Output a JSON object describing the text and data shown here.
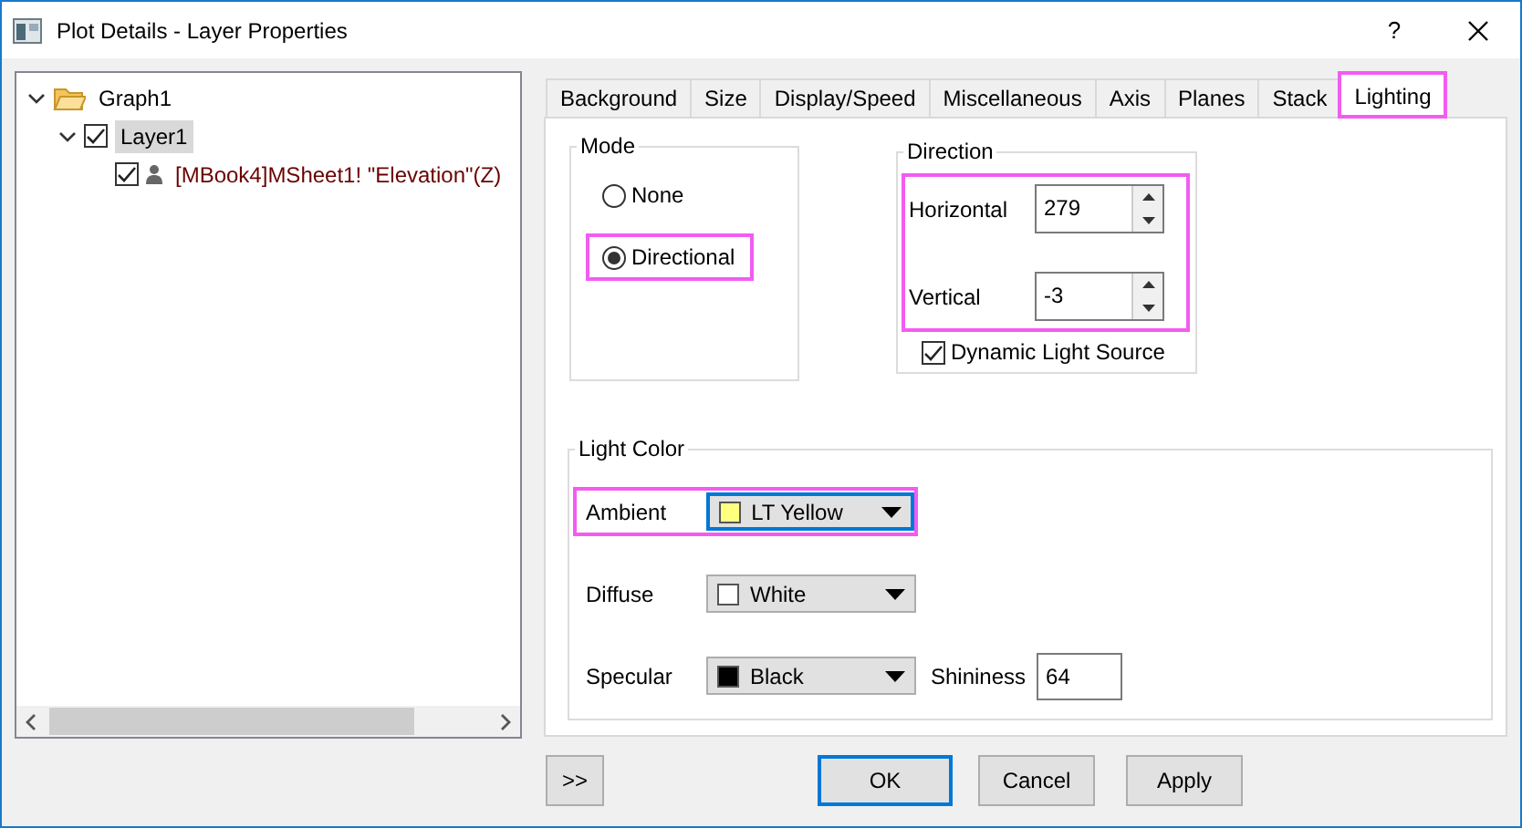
{
  "window": {
    "title": "Plot Details - Layer Properties",
    "help": "?"
  },
  "tree": [
    {
      "label": "Graph1",
      "kind": "folder",
      "expanded": true,
      "selected": false,
      "children": [
        {
          "label": "Layer1",
          "expanded": true,
          "checked": true,
          "selected": true,
          "children": [
            {
              "label": "[MBook4]MSheet1! \"Elevation\"(Z)",
              "kind": "plot",
              "checked": true,
              "selected": false
            }
          ]
        }
      ]
    }
  ],
  "tabs": [
    {
      "label": "Background",
      "selected": false,
      "highlighted": false
    },
    {
      "label": "Size",
      "selected": false,
      "highlighted": false
    },
    {
      "label": "Display/Speed",
      "selected": false,
      "highlighted": false
    },
    {
      "label": "Miscellaneous",
      "selected": false,
      "highlighted": false
    },
    {
      "label": "Axis",
      "selected": false,
      "highlighted": false
    },
    {
      "label": "Planes",
      "selected": false,
      "highlighted": false
    },
    {
      "label": "Stack",
      "selected": false,
      "highlighted": false
    },
    {
      "label": "Lighting",
      "selected": true,
      "highlighted": true
    }
  ],
  "mode": {
    "title": "Mode",
    "options": [
      {
        "label": "None",
        "selected": false,
        "highlighted": false
      },
      {
        "label": "Directional",
        "selected": true,
        "highlighted": true
      }
    ]
  },
  "direction": {
    "title": "Direction",
    "highlighted": true,
    "fields": [
      {
        "label": "Horizontal",
        "value": "279"
      },
      {
        "label": "Vertical",
        "value": "-3"
      }
    ],
    "dynamic": {
      "label": "Dynamic Light Source",
      "checked": true
    }
  },
  "light_color": {
    "title": "Light Color",
    "rows": [
      {
        "label": "Ambient",
        "value": "LT Yellow",
        "color": "#ffff80",
        "focused": true,
        "highlighted": true
      },
      {
        "label": "Diffuse",
        "value": "White",
        "color": "#ffffff",
        "focused": false,
        "highlighted": false
      },
      {
        "label": "Specular",
        "value": "Black",
        "color": "#000000",
        "focused": false,
        "highlighted": false
      }
    ],
    "shininess": {
      "label": "Shininess",
      "value": "64"
    }
  },
  "footer": {
    "expand": ">>",
    "buttons": [
      {
        "label": "OK",
        "default": true
      },
      {
        "label": "Cancel",
        "default": false
      },
      {
        "label": "Apply",
        "default": false
      }
    ]
  }
}
